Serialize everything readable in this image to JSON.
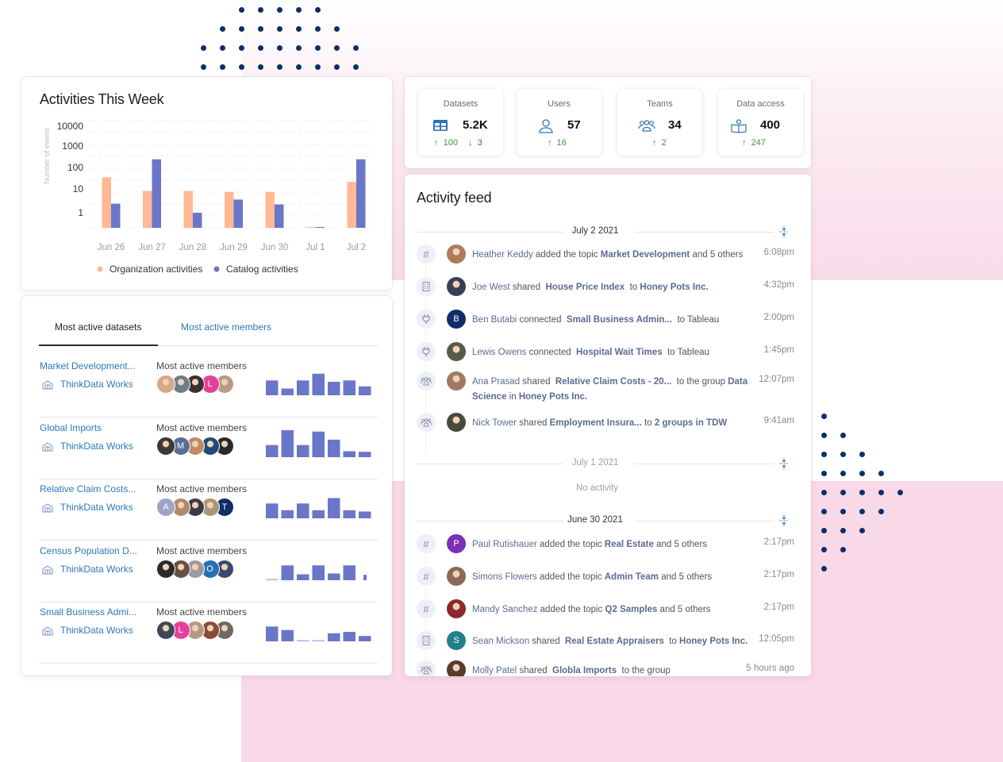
{
  "colors": {
    "org_bar": "#ffb994",
    "cat_bar": "#6a76c8",
    "link": "#2e78b8",
    "feed_name": "#5a6c8f",
    "up": "#3b9b3b",
    "down": "#c0392b",
    "dot": "#0d2e6b",
    "pink": "#f9d9e8"
  },
  "activities": {
    "title": "Activities This Week",
    "chart_data": {
      "type": "bar",
      "title": "Activities This Week",
      "xlabel": "",
      "ylabel": "Number of events",
      "yscale": "log",
      "ylim": [
        0.3,
        10000
      ],
      "yticks": [
        "10000",
        "1000",
        "100",
        "10",
        "1"
      ],
      "categories": [
        "Jun 26",
        "Jun 27",
        "Jun 28",
        "Jun 29",
        "Jun 30",
        "Jul 1",
        "Jul 2"
      ],
      "series": [
        {
          "name": "Organization activities",
          "color": "#ffb994",
          "values": [
            42,
            10,
            10,
            9,
            9,
            0,
            26
          ]
        },
        {
          "name": "Catalog activities",
          "color": "#6a76c8",
          "values": [
            2.6,
            280,
            1,
            4,
            2.4,
            0,
            280
          ]
        }
      ],
      "grid": true,
      "legend": "bottom"
    }
  },
  "datasets_panel": {
    "tabs": [
      {
        "label": "Most active datasets",
        "active": true
      },
      {
        "label": "Most active members",
        "active": false
      }
    ],
    "rows": [
      {
        "name": "Market Development...",
        "org": "ThinkData Works",
        "members_label": "Most active members",
        "avatars": [
          {
            "type": "photo",
            "color": "#d8a88a"
          },
          {
            "type": "photo",
            "color": "#6d7f86"
          },
          {
            "type": "photo",
            "color": "#3c3030"
          },
          {
            "type": "initial",
            "initial": "L",
            "color": "#e63f9a"
          },
          {
            "type": "photo",
            "color": "#b89a85"
          }
        ],
        "activity": [
          0.55,
          0.25,
          0.55,
          0.8,
          0.5,
          0.55,
          0.33
        ]
      },
      {
        "name": "Global Imports",
        "org": "ThinkData Works",
        "members_label": "Most active members",
        "avatars": [
          {
            "type": "photo",
            "color": "#3a3a3a"
          },
          {
            "type": "initial",
            "initial": "M",
            "color": "#5b6f93"
          },
          {
            "type": "photo",
            "color": "#c08a68"
          },
          {
            "type": "photo",
            "color": "#1f4d7a"
          },
          {
            "type": "photo",
            "color": "#2a2a2a"
          }
        ],
        "activity": [
          0.45,
          1.0,
          0.45,
          0.95,
          0.65,
          0.22,
          0.2
        ]
      },
      {
        "name": "Relative Claim Costs...",
        "org": "ThinkData Works",
        "members_label": "Most active members",
        "avatars": [
          {
            "type": "initial",
            "initial": "A",
            "color": "#9aa6c4"
          },
          {
            "type": "photo",
            "color": "#b08a6a"
          },
          {
            "type": "photo",
            "color": "#3b3b45"
          },
          {
            "type": "photo",
            "color": "#a89878"
          },
          {
            "type": "initial",
            "initial": "T",
            "color": "#102d6a"
          }
        ],
        "activity": [
          0.55,
          0.3,
          0.55,
          0.3,
          0.75,
          0.3,
          0.25
        ]
      },
      {
        "name": "Census Population D...",
        "org": "ThinkData Works",
        "members_label": "Most active members",
        "avatars": [
          {
            "type": "photo",
            "color": "#2b2b2b"
          },
          {
            "type": "photo",
            "color": "#6a5040"
          },
          {
            "type": "photo",
            "color": "#9a9aa0"
          },
          {
            "type": "initial",
            "initial": "O",
            "color": "#2470b3"
          },
          {
            "type": "photo",
            "color": "#3a4a6a"
          }
        ],
        "activity": [
          0.03,
          0.55,
          0.22,
          0.55,
          0.25,
          0.55,
          0.2
        ]
      },
      {
        "name": "Small Business Admi...",
        "org": "ThinkData Works",
        "members_label": "Most active members",
        "avatars": [
          {
            "type": "photo",
            "color": "#3a4a5a"
          },
          {
            "type": "initial",
            "initial": "L",
            "color": "#e63f9a"
          },
          {
            "type": "photo",
            "color": "#b69a80"
          },
          {
            "type": "photo",
            "color": "#8a4a3a"
          },
          {
            "type": "photo",
            "color": "#6e6a60"
          }
        ],
        "activity": [
          0.55,
          0.42,
          0.04,
          0.04,
          0.3,
          0.35,
          0.2
        ]
      }
    ]
  },
  "stats": [
    {
      "label": "Datasets",
      "value": "5.2K",
      "icon": "table-icon",
      "up": "100",
      "down": "3"
    },
    {
      "label": "Users",
      "value": "57",
      "icon": "user-icon",
      "up": "16"
    },
    {
      "label": "Teams",
      "value": "34",
      "icon": "team-icon",
      "up": "2"
    },
    {
      "label": "Data access",
      "value": "400",
      "icon": "book-reader-icon",
      "up": "247"
    }
  ],
  "feed": {
    "title": "Activity feed",
    "groups": [
      {
        "date": "July 2 2021",
        "items": [
          {
            "icon": "hashtag-icon",
            "avatar": {
              "type": "photo",
              "color": "#b07a5a"
            },
            "parts": [
              [
                "who",
                "Heather Keddy"
              ],
              [
                "txt",
                " added the topic "
              ],
              [
                "obj",
                "Market Development"
              ],
              [
                "txt",
                " and 5 others"
              ]
            ],
            "time": "6:08pm"
          },
          {
            "icon": "building-icon",
            "avatar": {
              "type": "photo",
              "color": "#3a3f55"
            },
            "parts": [
              [
                "who",
                "Joe West"
              ],
              [
                "txt",
                " shared  "
              ],
              [
                "obj",
                "House Price Index"
              ],
              [
                "txt",
                "  to "
              ],
              [
                "obj",
                "Honey Pots Inc."
              ]
            ],
            "time": "4:32pm"
          },
          {
            "icon": "plug-icon",
            "avatar": {
              "type": "initial",
              "initial": "B",
              "color": "#0f2d6b"
            },
            "parts": [
              [
                "who",
                "Ben Butabi"
              ],
              [
                "txt",
                " connected  "
              ],
              [
                "obj",
                "Small Business Admin..."
              ],
              [
                "txt",
                "  to Tableau"
              ]
            ],
            "time": "2:00pm"
          },
          {
            "icon": "plug-icon",
            "avatar": {
              "type": "photo",
              "color": "#5a5a4a"
            },
            "parts": [
              [
                "who",
                "Lewis Owens"
              ],
              [
                "txt",
                " connected  "
              ],
              [
                "obj",
                "Hospital Wait Times"
              ],
              [
                "txt",
                "  to Tableau"
              ]
            ],
            "time": "1:45pm"
          },
          {
            "icon": "group-icon",
            "avatar": {
              "type": "photo",
              "color": "#a07a60"
            },
            "parts": [
              [
                "who",
                "Ana Prasad"
              ],
              [
                "txt",
                " shared  "
              ],
              [
                "obj",
                "Relative Claim Costs - 20..."
              ],
              [
                "txt",
                "  to the group "
              ],
              [
                "obj",
                "Data Science"
              ],
              [
                "txt",
                " in "
              ],
              [
                "obj",
                "Honey Pots Inc."
              ]
            ],
            "time": "12:07pm"
          },
          {
            "icon": "group-icon",
            "avatar": {
              "type": "photo",
              "color": "#4a4a3a"
            },
            "parts": [
              [
                "who",
                "Nick Tower"
              ],
              [
                "txt",
                " shared "
              ],
              [
                "obj",
                "Employment Insura..."
              ],
              [
                "txt",
                " to "
              ],
              [
                "obj",
                "2 groups in TDW"
              ]
            ],
            "time": "9:41am"
          }
        ]
      },
      {
        "date": "July 1 2021",
        "empty_text": "No activity",
        "items": []
      },
      {
        "date": "June 30 2021",
        "items": [
          {
            "icon": "hashtag-icon",
            "avatar": {
              "type": "initial",
              "initial": "P",
              "color": "#7b2fb5"
            },
            "parts": [
              [
                "who",
                "Paul Rutishauer"
              ],
              [
                "txt",
                " added the topic "
              ],
              [
                "obj",
                "Real Estate"
              ],
              [
                "txt",
                " and 5 others"
              ]
            ],
            "time": "2:17pm"
          },
          {
            "icon": "hashtag-icon",
            "avatar": {
              "type": "photo",
              "color": "#8a6a55"
            },
            "parts": [
              [
                "who",
                "Simons Flowers"
              ],
              [
                "txt",
                " added the topic "
              ],
              [
                "obj",
                "Admin Team"
              ],
              [
                "txt",
                " and 5 others"
              ]
            ],
            "time": "2:17pm"
          },
          {
            "icon": "hashtag-icon",
            "avatar": {
              "type": "photo",
              "color": "#8a2a2a"
            },
            "parts": [
              [
                "who",
                "Mandy Sanchez"
              ],
              [
                "txt",
                " added the topic "
              ],
              [
                "obj",
                "Q2 Samples"
              ],
              [
                "txt",
                " and 5 others"
              ]
            ],
            "time": "2:17pm"
          },
          {
            "icon": "building-icon",
            "avatar": {
              "type": "initial",
              "initial": "S",
              "color": "#22808a"
            },
            "parts": [
              [
                "who",
                "Sean Mickson"
              ],
              [
                "txt",
                " shared  "
              ],
              [
                "obj",
                "Real Estate Appraisers"
              ],
              [
                "txt",
                "  to "
              ],
              [
                "obj",
                "Honey Pots Inc."
              ]
            ],
            "time": "12:05pm"
          },
          {
            "icon": "group-icon",
            "avatar": {
              "type": "photo",
              "color": "#5a3a2a"
            },
            "parts": [
              [
                "who",
                "Molly Patel"
              ],
              [
                "txt",
                " shared  "
              ],
              [
                "obj",
                "Globla Imports"
              ],
              [
                "txt",
                "  to the group"
              ]
            ],
            "time": "5 hours ago"
          }
        ]
      }
    ]
  }
}
